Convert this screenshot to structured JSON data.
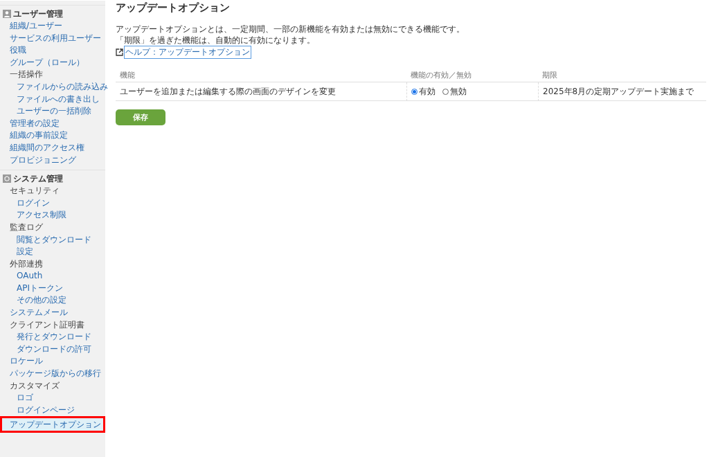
{
  "sidebar": {
    "sections": [
      {
        "title": "ユーザー管理",
        "kind": "user",
        "items": [
          {
            "label": "組織/ユーザー",
            "kind": "link",
            "selected": false
          },
          {
            "label": "サービスの利用ユーザー",
            "kind": "link",
            "selected": false
          },
          {
            "label": "役職",
            "kind": "link",
            "selected": false
          },
          {
            "label": "グループ（ロール）",
            "kind": "link",
            "selected": false
          },
          {
            "label": "一括操作",
            "kind": "group",
            "selected": false,
            "children": [
              {
                "label": "ファイルからの読み込み",
                "kind": "link",
                "selected": false
              },
              {
                "label": "ファイルへの書き出し",
                "kind": "link",
                "selected": false
              },
              {
                "label": "ユーザーの一括削除",
                "kind": "link",
                "selected": false
              }
            ]
          },
          {
            "label": "管理者の設定",
            "kind": "link",
            "selected": false
          },
          {
            "label": "組織の事前設定",
            "kind": "link",
            "selected": false
          },
          {
            "label": "組織間のアクセス権",
            "kind": "link",
            "selected": false
          },
          {
            "label": "プロビジョニング",
            "kind": "link",
            "selected": false
          }
        ]
      },
      {
        "title": "システム管理",
        "kind": "system",
        "items": [
          {
            "label": "セキュリティ",
            "kind": "group",
            "selected": false,
            "children": [
              {
                "label": "ログイン",
                "kind": "link",
                "selected": false
              },
              {
                "label": "アクセス制限",
                "kind": "link",
                "selected": false
              }
            ]
          },
          {
            "label": "監査ログ",
            "kind": "group",
            "selected": false,
            "children": [
              {
                "label": "閲覧とダウンロード",
                "kind": "link",
                "selected": false
              },
              {
                "label": "設定",
                "kind": "link",
                "selected": false
              }
            ]
          },
          {
            "label": "外部連携",
            "kind": "group",
            "selected": false,
            "children": [
              {
                "label": "OAuth",
                "kind": "link",
                "selected": false
              },
              {
                "label": "APIトークン",
                "kind": "link",
                "selected": false
              },
              {
                "label": "その他の設定",
                "kind": "link",
                "selected": false
              }
            ]
          },
          {
            "label": "システムメール",
            "kind": "link",
            "selected": false
          },
          {
            "label": "クライアント証明書",
            "kind": "group",
            "selected": false,
            "children": [
              {
                "label": "発行とダウンロード",
                "kind": "link",
                "selected": false
              },
              {
                "label": "ダウンロードの許可",
                "kind": "link",
                "selected": false
              }
            ]
          },
          {
            "label": "ロケール",
            "kind": "link",
            "selected": false
          },
          {
            "label": "パッケージ版からの移行",
            "kind": "link",
            "selected": false
          },
          {
            "label": "カスタマイズ",
            "kind": "group",
            "selected": false,
            "children": [
              {
                "label": "ロゴ",
                "kind": "link",
                "selected": false
              },
              {
                "label": "ログインページ",
                "kind": "link",
                "selected": false
              }
            ]
          },
          {
            "label": "アップデートオプション",
            "kind": "link",
            "selected": true
          }
        ]
      }
    ]
  },
  "main": {
    "title": "アップデートオプション",
    "description": [
      "アップデートオプションとは、一定期間、一部の新機能を有効または無効にできる機能です。",
      "「期限」を過ぎた機能は、自動的に有効になります。"
    ],
    "help_link": "ヘルプ：アップデートオプション",
    "table": {
      "columns": [
        "機能",
        "機能の有効／無効",
        "期限"
      ],
      "rows": [
        {
          "feature": "ユーザーを追加または編集する際の画面のデザインを変更",
          "options": [
            {
              "label": "有効",
              "selected": true
            },
            {
              "label": "無効",
              "selected": false
            }
          ],
          "deadline": "2025年8月の定期アップデート実施まで"
        }
      ]
    },
    "save_button": "保存"
  }
}
